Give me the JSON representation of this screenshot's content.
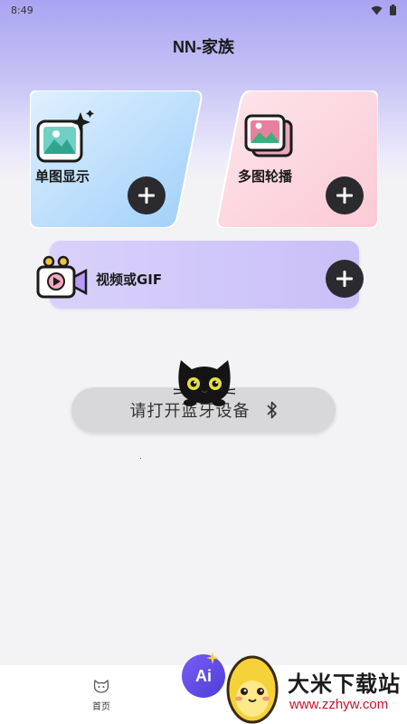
{
  "status_bar": {
    "time": "8:49",
    "wifi_icon": "wifi-icon",
    "battery_icon": "battery-icon"
  },
  "header": {
    "title": "NN-家族"
  },
  "cards": [
    {
      "label": "单图显示",
      "icon": "single-image-sparkle-icon",
      "action_icon": "plus-icon",
      "color": "#a8d6fb"
    },
    {
      "label": "多图轮播",
      "icon": "multi-image-icon",
      "action_icon": "plus-icon",
      "color": "#fdd0dc"
    },
    {
      "label": "视频或GIF",
      "icon": "video-camera-icon",
      "action_icon": "plus-icon",
      "color": "#d2c9fa"
    }
  ],
  "bluetooth": {
    "label": "请打开蓝牙设备",
    "icon": "bluetooth-icon"
  },
  "mascot": {
    "icon": "black-cat-icon"
  },
  "bottom_nav": {
    "home_label": "首页",
    "home_icon": "cat-home-icon",
    "ai_label": "Ai",
    "ai_color": "#6b4ef0"
  },
  "watermark": {
    "name": "大米下载站",
    "url": "www.zzhyw.com",
    "logo_icon": "egg-mascot-icon"
  }
}
